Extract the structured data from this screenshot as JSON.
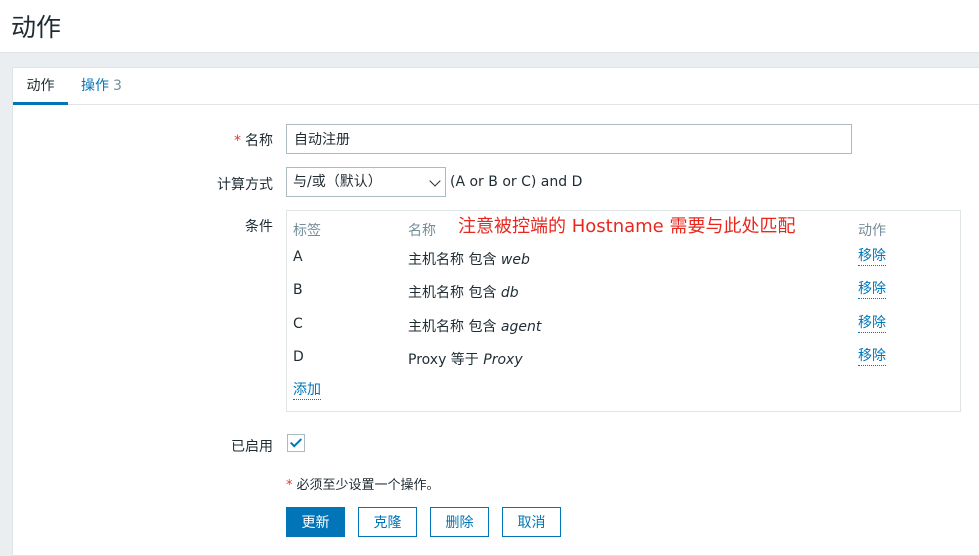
{
  "page": {
    "title": "动作"
  },
  "tabs": [
    {
      "label": "动作"
    },
    {
      "label": "操作",
      "count": "3"
    }
  ],
  "form": {
    "name_label": "名称",
    "name_value": "自动注册",
    "calc_label": "计算方式",
    "calc_value": "与/或（默认）",
    "formula": "(A or B or C) and D",
    "conditions_label": "条件",
    "enabled_label": "已启用",
    "enabled": true,
    "required_note": "必须至少设置一个操作。"
  },
  "conditions": {
    "headers": {
      "label": "标签",
      "name": "名称",
      "action": "动作"
    },
    "rows": [
      {
        "label": "A",
        "name_prefix": "主机名称 包含",
        "name_value": "web",
        "action": "移除"
      },
      {
        "label": "B",
        "name_prefix": "主机名称 包含",
        "name_value": "db",
        "action": "移除"
      },
      {
        "label": "C",
        "name_prefix": "主机名称 包含",
        "name_value": "agent",
        "action": "移除"
      },
      {
        "label": "D",
        "name_prefix": "Proxy 等于",
        "name_value": "Proxy",
        "action": "移除"
      }
    ],
    "add_label": "添加"
  },
  "annotation": "注意被控端的 Hostname 需要与此处匹配",
  "buttons": {
    "update": "更新",
    "clone": "克隆",
    "delete": "删除",
    "cancel": "取消"
  },
  "colors": {
    "accent": "#0275b8",
    "annotation": "#e8281e",
    "required": "#e33734"
  }
}
